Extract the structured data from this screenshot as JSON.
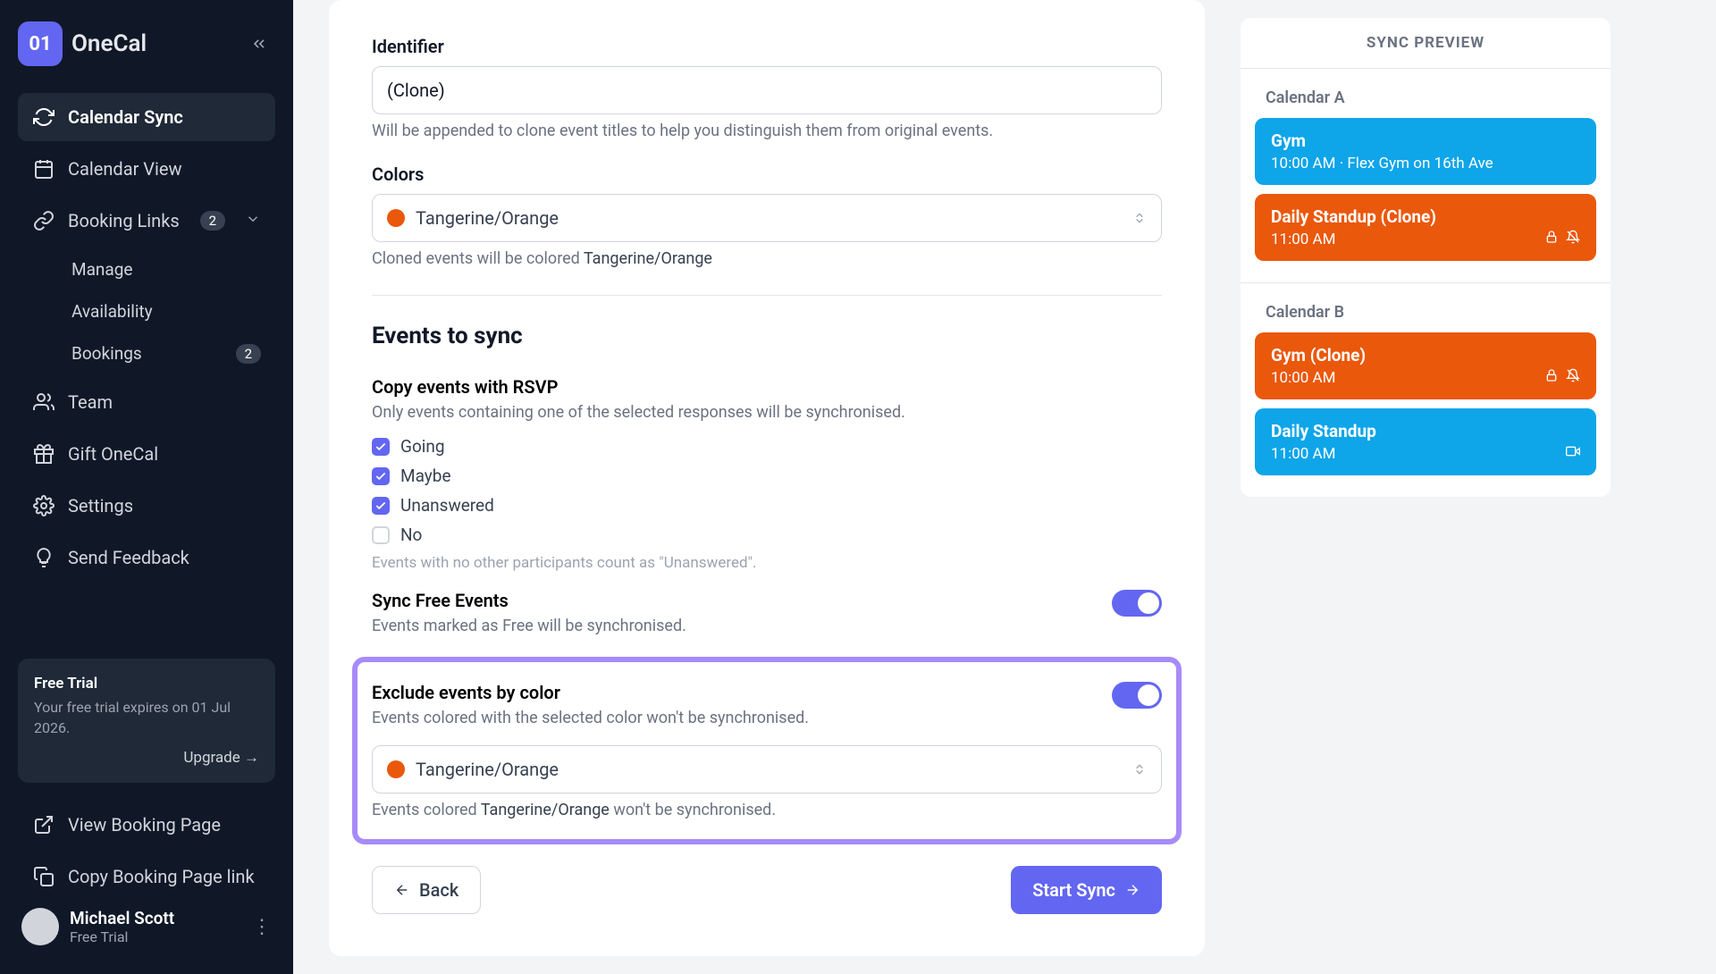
{
  "brand": {
    "logo_badge": "01",
    "name": "OneCal"
  },
  "sidebar": {
    "items": [
      {
        "label": "Calendar Sync",
        "active": true
      },
      {
        "label": "Calendar View"
      },
      {
        "label": "Booking Links",
        "badge": "2"
      }
    ],
    "sub_items": [
      {
        "label": "Manage"
      },
      {
        "label": "Availability"
      },
      {
        "label": "Bookings",
        "badge": "2"
      }
    ],
    "items2": [
      {
        "label": "Team"
      },
      {
        "label": "Gift OneCal"
      },
      {
        "label": "Settings"
      },
      {
        "label": "Send Feedback"
      }
    ],
    "trial": {
      "title": "Free Trial",
      "desc": "Your free trial expires on 01 Jul 2026.",
      "cta": "Upgrade →"
    },
    "bottom_links": [
      {
        "label": "View Booking Page"
      },
      {
        "label": "Copy Booking Page link"
      }
    ],
    "user": {
      "name": "Michael Scott",
      "plan": "Free Trial"
    }
  },
  "form": {
    "identifier": {
      "label": "Identifier",
      "value": "(Clone)",
      "help": "Will be appended to clone event titles to help you distinguish them from original events."
    },
    "colors": {
      "label": "Colors",
      "value": "Tangerine/Orange",
      "help_prefix": "Cloned events will be colored ",
      "help_color": "Tangerine/Orange"
    },
    "section_title": "Events to sync",
    "rsvp": {
      "label": "Copy events with RSVP",
      "desc": "Only events containing one of the selected responses will be synchronised.",
      "options": [
        {
          "label": "Going",
          "checked": true
        },
        {
          "label": "Maybe",
          "checked": true
        },
        {
          "label": "Unanswered",
          "checked": true
        },
        {
          "label": "No",
          "checked": false
        }
      ],
      "note": "Events with no other participants count as \"Unanswered\"."
    },
    "sync_free": {
      "label": "Sync Free Events",
      "desc": "Events marked as Free will be synchronised."
    },
    "exclude": {
      "label": "Exclude events by color",
      "desc": "Events colored with the selected color won't be synchronised.",
      "value": "Tangerine/Orange",
      "help_prefix": "Events colored ",
      "help_color": "Tangerine/Orange",
      "help_suffix": " won't be synchronised."
    },
    "footer": {
      "back": "Back",
      "start": "Start Sync"
    }
  },
  "preview": {
    "title": "SYNC PREVIEW",
    "cal_a": {
      "label": "Calendar A",
      "events": [
        {
          "title": "Gym",
          "time": "10:00 AM · Flex Gym on 16th Ave",
          "color": "blue"
        },
        {
          "title": "Daily Standup (Clone)",
          "time": "11:00 AM",
          "color": "orange",
          "icons": "lock-bell"
        }
      ]
    },
    "cal_b": {
      "label": "Calendar B",
      "events": [
        {
          "title": "Gym (Clone)",
          "time": "10:00 AM",
          "color": "orange",
          "icons": "lock-bell"
        },
        {
          "title": "Daily Standup",
          "time": "11:00 AM",
          "color": "blue",
          "icons": "video"
        }
      ]
    }
  }
}
